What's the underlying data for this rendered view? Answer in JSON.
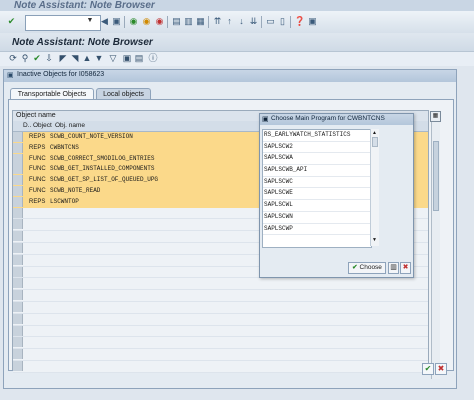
{
  "window": {
    "title": "Note Assistant: Note Browser"
  },
  "toolbar": {
    "command_field_value": "",
    "icons": [
      "enter-icon",
      "save-icon",
      "back-icon",
      "exit-icon",
      "cancel-icon",
      "print-icon",
      "find-icon",
      "find-next-icon",
      "first-page-icon",
      "prev-page-icon",
      "next-page-icon",
      "last-page-icon",
      "new-session-icon",
      "shortcut-icon",
      "help-icon",
      "layout-icon"
    ]
  },
  "app": {
    "title": "Note Assistant: Note Browser",
    "toolbar_icons": [
      "refresh-icon",
      "find-icon",
      "filter-icon",
      "download-icon",
      "sort-asc-icon",
      "sort-desc-icon",
      "filter-funnel-icon",
      "display-icon",
      "info-icon"
    ]
  },
  "dialog": {
    "title": "Inactive Objects for I058623",
    "tabs": [
      {
        "label": "Transportable Objects",
        "active": true
      },
      {
        "label": "Local objects",
        "active": false
      }
    ],
    "grid": {
      "title": "Object name",
      "columns": [
        "D..",
        "Object",
        "Obj. name"
      ],
      "rows": [
        {
          "object": "REPS",
          "name": "SCWB_COUNT_NOTE_VERSION"
        },
        {
          "object": "REPS",
          "name": "CWBNTCNS"
        },
        {
          "object": "FUNC",
          "name": "SCWB_CORRECT_SMODILOG_ENTRIES"
        },
        {
          "object": "FUNC",
          "name": "SCWB_GET_INSTALLED_COMPONENTS"
        },
        {
          "object": "FUNC",
          "name": "SCWB_GET_SP_LIST_OF_QUEUED_UPG"
        },
        {
          "object": "FUNC",
          "name": "SCWB_NOTE_READ"
        },
        {
          "object": "REPS",
          "name": "LSCWNTOP"
        }
      ]
    }
  },
  "popup": {
    "title": "Choose Main Program for CWBNTCNS",
    "items": [
      "RS_EARLYWATCH_STATISTICS",
      "SAPLSCW2",
      "SAPLSCWA",
      "SAPLSCWB_API",
      "SAPLSCWC",
      "SAPLSCWE",
      "SAPLSCWL",
      "SAPLSCWN",
      "SAPLSCWP"
    ],
    "choose_label": "Choose"
  },
  "colors": {
    "highlight_row": "#fbd98a",
    "title_text": "#5a6e8a"
  }
}
